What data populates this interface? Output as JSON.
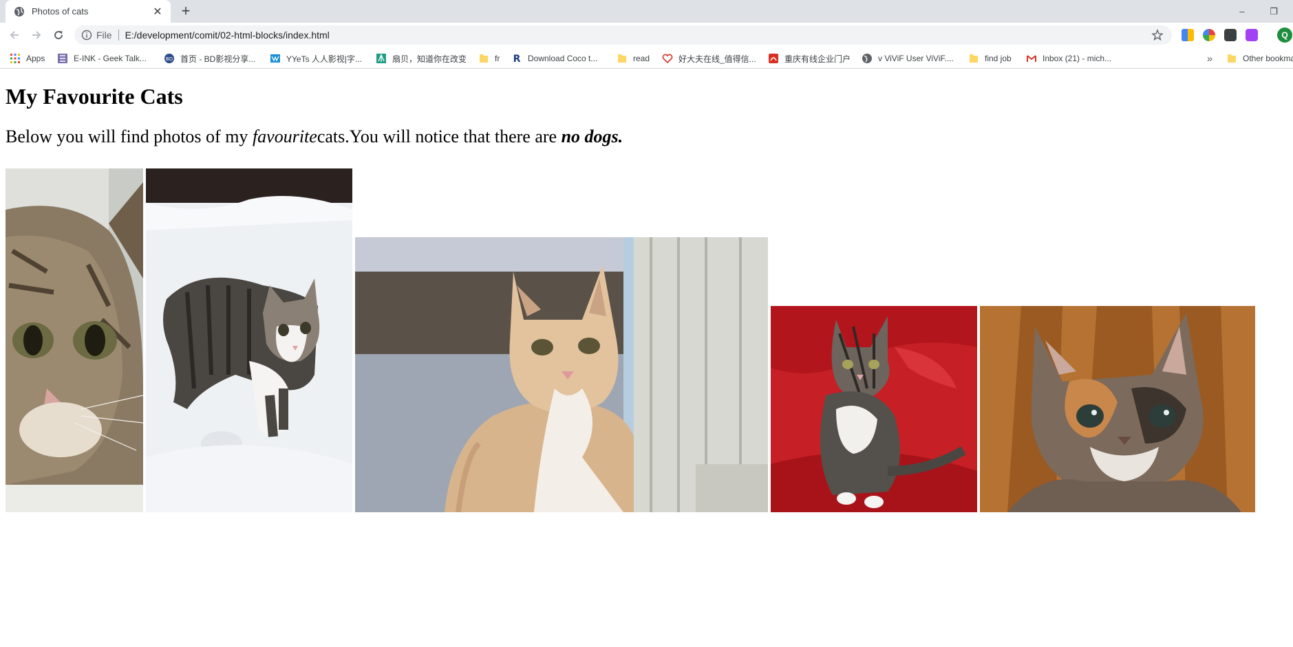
{
  "browser": {
    "tab": {
      "title": "Photos of cats",
      "favicon": "globe-icon",
      "close": "✕"
    },
    "new_tab": "+",
    "window_controls": {
      "minimize": "–",
      "restore": "❐"
    },
    "address": {
      "scheme": "File",
      "url": "E:/development/comit/02-html-blocks/index.html"
    },
    "profile_initial": "Q",
    "bookmarks": [
      {
        "label": "Apps",
        "icon": "apps-grid-icon"
      },
      {
        "label": "E-INK - Geek Talk...",
        "icon": "eink-icon"
      },
      {
        "label": "首页 - BD影视分享...",
        "icon": "bd-icon"
      },
      {
        "label": "YYeTs 人人影视|字...",
        "icon": "yyets-icon"
      },
      {
        "label": "扇贝，知道你在改变",
        "icon": "shanbay-icon"
      },
      {
        "label": "fr",
        "icon": "folder-icon"
      },
      {
        "label": "Download Coco t...",
        "icon": "r-icon"
      },
      {
        "label": "read",
        "icon": "folder-icon"
      },
      {
        "label": "好大夫在线_值得信...",
        "icon": "heart-icon"
      },
      {
        "label": "重庆有线企业门户",
        "icon": "cq-icon"
      },
      {
        "label": "v ViViF User ViViF....",
        "icon": "globe-icon"
      },
      {
        "label": "find job",
        "icon": "folder-icon"
      },
      {
        "label": "Inbox (21) - mich...",
        "icon": "gmail-icon"
      },
      {
        "label": "Other bookmarks",
        "icon": "folder-icon"
      }
    ],
    "bookmarks_overflow": "»"
  },
  "page": {
    "heading": "My Favourite Cats",
    "intro": {
      "before": "Below you will find photos of my ",
      "emphasis": "favourite",
      "middle": "cats.You will notice that there are ",
      "strong": "no dogs."
    }
  },
  "photos": [
    {
      "name": "tabby-kitten-closeup"
    },
    {
      "name": "kitten-in-snow"
    },
    {
      "name": "ginger-cat-by-post"
    },
    {
      "name": "kitten-on-red-chair"
    },
    {
      "name": "calico-kitten"
    }
  ]
}
